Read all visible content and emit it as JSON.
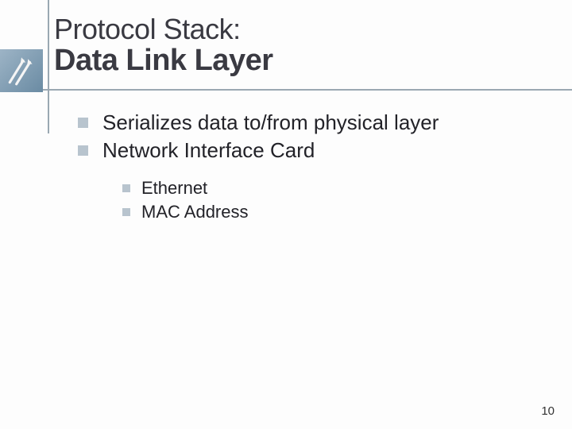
{
  "title": {
    "line1": "Protocol Stack:",
    "line2": "Data Link Layer"
  },
  "bullets": [
    {
      "text": "Serializes data to/from physical layer"
    },
    {
      "text": "Network Interface Card"
    }
  ],
  "sub_bullets": [
    {
      "text": "Ethernet"
    },
    {
      "text": "MAC Address"
    }
  ],
  "page_number": "10"
}
